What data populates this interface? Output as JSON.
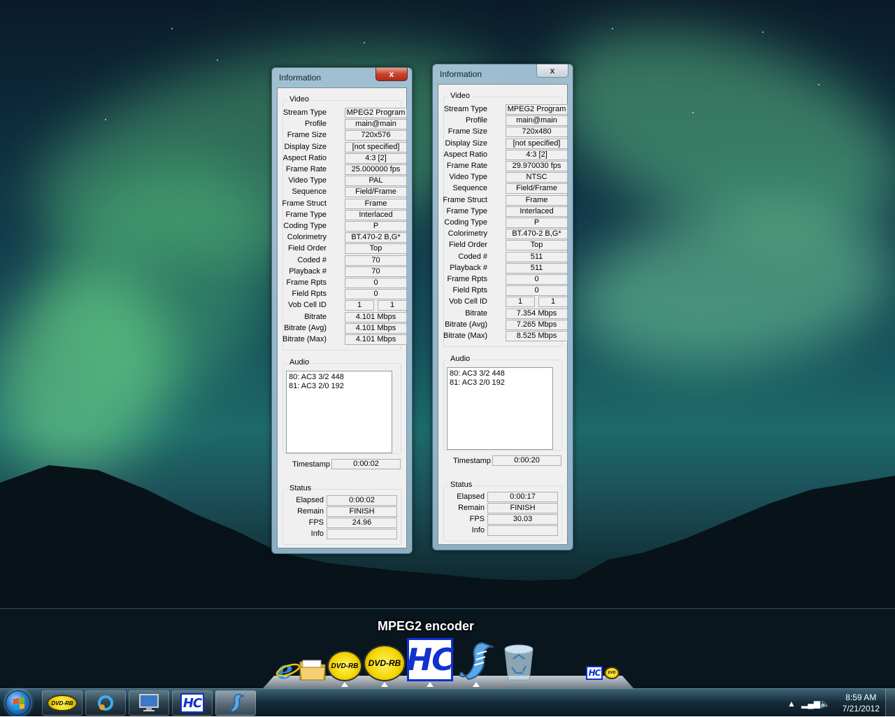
{
  "window_left": {
    "title": "Information",
    "close_label": "x",
    "video_label": "Video",
    "video_rows": [
      {
        "label": "Stream Type",
        "value": "MPEG2 Program"
      },
      {
        "label": "Profile",
        "value": "main@main"
      },
      {
        "label": "Frame Size",
        "value": "720x576"
      },
      {
        "label": "Display Size",
        "value": "[not specified]"
      },
      {
        "label": "Aspect Ratio",
        "value": "4:3 [2]"
      },
      {
        "label": "Frame Rate",
        "value": "25.000000 fps"
      },
      {
        "label": "Video Type",
        "value": "PAL"
      },
      {
        "label": "Sequence",
        "value": "Field/Frame"
      },
      {
        "label": "Frame Struct",
        "value": "Frame"
      },
      {
        "label": "Frame Type",
        "value": "Interlaced"
      },
      {
        "label": "Coding Type",
        "value": "P"
      },
      {
        "label": "Colorimetry",
        "value": "BT.470-2 B,G*"
      },
      {
        "label": "Field Order",
        "value": "Top"
      },
      {
        "label": "Coded #",
        "value": "70"
      },
      {
        "label": "Playback #",
        "value": "70"
      },
      {
        "label": "Frame Rpts",
        "value": "0"
      },
      {
        "label": "Field Rpts",
        "value": "0"
      },
      {
        "label": "Vob Cell ID",
        "value": "1",
        "value2": "1"
      },
      {
        "label": "Bitrate",
        "value": "4.101 Mbps"
      },
      {
        "label": "Bitrate (Avg)",
        "value": "4.101 Mbps"
      },
      {
        "label": "Bitrate (Max)",
        "value": "4.101 Mbps"
      }
    ],
    "audio_label": "Audio",
    "audio_tracks": [
      "80: AC3 3/2 448",
      "81: AC3 2/0 192"
    ],
    "timestamp_label": "Timestamp",
    "timestamp_value": "0:00:02",
    "status_label": "Status",
    "status_rows": [
      {
        "label": "Elapsed",
        "value": "0:00:02"
      },
      {
        "label": "Remain",
        "value": "FINISH"
      },
      {
        "label": "FPS",
        "value": "24.96"
      },
      {
        "label": "Info",
        "value": ""
      }
    ]
  },
  "window_right": {
    "title": "Information",
    "close_label": "x",
    "video_label": "Video",
    "video_rows": [
      {
        "label": "Stream Type",
        "value": "MPEG2 Program"
      },
      {
        "label": "Profile",
        "value": "main@main"
      },
      {
        "label": "Frame Size",
        "value": "720x480"
      },
      {
        "label": "Display Size",
        "value": "[not specified]"
      },
      {
        "label": "Aspect Ratio",
        "value": "4:3 [2]"
      },
      {
        "label": "Frame Rate",
        "value": "29.970030 fps"
      },
      {
        "label": "Video Type",
        "value": "NTSC"
      },
      {
        "label": "Sequence",
        "value": "Field/Frame"
      },
      {
        "label": "Frame Struct",
        "value": "Frame"
      },
      {
        "label": "Frame Type",
        "value": "Interlaced"
      },
      {
        "label": "Coding Type",
        "value": "P"
      },
      {
        "label": "Colorimetry",
        "value": "BT.470-2 B,G*"
      },
      {
        "label": "Field Order",
        "value": "Top"
      },
      {
        "label": "Coded #",
        "value": "511"
      },
      {
        "label": "Playback #",
        "value": "511"
      },
      {
        "label": "Frame Rpts",
        "value": "0"
      },
      {
        "label": "Field Rpts",
        "value": "0"
      },
      {
        "label": "Vob Cell ID",
        "value": "1",
        "value2": "1"
      },
      {
        "label": "Bitrate",
        "value": "7.354 Mbps"
      },
      {
        "label": "Bitrate (Avg)",
        "value": "7.265 Mbps"
      },
      {
        "label": "Bitrate (Max)",
        "value": "8.525 Mbps"
      }
    ],
    "audio_label": "Audio",
    "audio_tracks": [
      "80: AC3 3/2 448",
      "81: AC3 2/0 192"
    ],
    "timestamp_label": "Timestamp",
    "timestamp_value": "0:00:20",
    "status_label": "Status",
    "status_rows": [
      {
        "label": "Elapsed",
        "value": "0:00:17"
      },
      {
        "label": "Remain",
        "value": "FINISH"
      },
      {
        "label": "FPS",
        "value": "30.03"
      },
      {
        "label": "Info",
        "value": ""
      }
    ]
  },
  "dock": {
    "caption": "MPEG2 encoder",
    "icons": [
      "ie-icon",
      "folder-icon",
      "dvdrb-icon",
      "dvdrb-icon",
      "hc-encoder-icon",
      "script-scroll-icon",
      "recycle-bin-icon",
      "hc-small-icon"
    ]
  },
  "taskbar": {
    "clock_time": "8:59 AM",
    "clock_date": "7/21/2012",
    "dvdrb_label": "DVD-RB",
    "hc_label": "HC"
  },
  "colors": {
    "title_close_red": "#c8452c",
    "hc_blue": "#1030d0",
    "dvd_yellow": "#f3d400"
  }
}
